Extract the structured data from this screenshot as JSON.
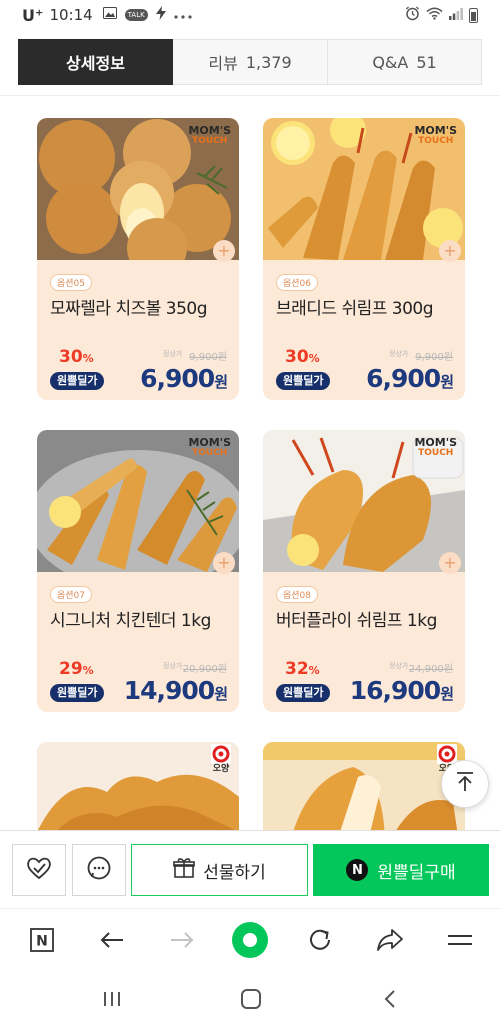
{
  "status": {
    "carrier": "U⁺",
    "time": "10:14",
    "talk": "TALK"
  },
  "tabs": [
    {
      "label": "상세정보",
      "count": ""
    },
    {
      "label": "리뷰",
      "count": "1,379"
    },
    {
      "label": "Q&A",
      "count": "51"
    }
  ],
  "products": [
    {
      "option": "옵션05",
      "name": "모짜렐라 치즈볼 350g",
      "discount": "30",
      "discount_unit": "%",
      "orig_label": "정상가",
      "orig_price": "9,900원",
      "badge": "원쁠딜가",
      "price": "6,900",
      "price_unit": "원",
      "brand_line1": "MOM'S",
      "brand_line2": "TOUCH"
    },
    {
      "option": "옵션06",
      "name": "브래디드 쉬림프 300g",
      "discount": "30",
      "discount_unit": "%",
      "orig_label": "정상가",
      "orig_price": "9,900원",
      "badge": "원쁠딜가",
      "price": "6,900",
      "price_unit": "원",
      "brand_line1": "MOM'S",
      "brand_line2": "TOUCH"
    },
    {
      "option": "옵션07",
      "name": "시그니처 치킨텐더 1kg",
      "discount": "29",
      "discount_unit": "%",
      "orig_label": "정상가",
      "orig_price": "20,900원",
      "badge": "원쁠딜가",
      "price": "14,900",
      "price_unit": "원",
      "brand_line1": "MOM'S",
      "brand_line2": "TOUCH"
    },
    {
      "option": "옵션08",
      "name": "버터플라이 쉬림프 1kg",
      "discount": "32",
      "discount_unit": "%",
      "orig_label": "정상가",
      "orig_price": "24,900원",
      "badge": "원쁠딜가",
      "price": "16,900",
      "price_unit": "원",
      "brand_line1": "MOM'S",
      "brand_line2": "TOUCH"
    },
    {
      "brand_line1": "오양"
    },
    {
      "brand_line1": "오양"
    }
  ],
  "actions": {
    "gift_label": "선물하기",
    "buy_label": "원쁠딜구매",
    "buy_logo": "N"
  },
  "browser": {
    "tab_logo": "N"
  },
  "colors": {
    "accent_green": "#03c75a",
    "discount_red": "#ee3b25",
    "price_navy": "#1d3a7e",
    "card_bg": "#fde9d8"
  },
  "icons": [
    "gallery-icon",
    "talk-icon",
    "bolt-icon",
    "more-icon",
    "alarm-icon",
    "wifi-icon",
    "signal-icon",
    "battery-icon",
    "heart-check-icon",
    "chat-icon",
    "gift-icon",
    "arrow-up-icon",
    "back-arrow-icon",
    "forward-arrow-icon",
    "home-circle-icon",
    "refresh-icon",
    "share-icon",
    "menu-icon",
    "recent-apps-icon",
    "home-icon",
    "back-icon"
  ]
}
